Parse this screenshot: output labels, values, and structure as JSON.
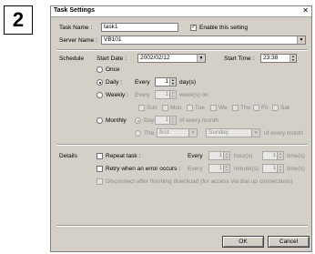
{
  "badge": "2",
  "window": {
    "title": "Task Settings",
    "close_icon": "close-icon"
  },
  "task_name": {
    "label": "Task Name :",
    "value": "task1"
  },
  "enable": {
    "label": "Enable this setting",
    "checked": true
  },
  "server_name": {
    "label": "Server Name :",
    "value": "VB101"
  },
  "schedule": {
    "label": "Schedule",
    "start_date_label": "Start Date :",
    "start_date": "2002/02/12",
    "start_time_label": "Start Time :",
    "start_time": "23:38",
    "once": "Once",
    "daily": "Daily :",
    "daily_every": "Every",
    "daily_value": "1",
    "daily_unit": "day(s)",
    "weekly": "Weekly :",
    "weekly_every": "Every",
    "weekly_value": "1",
    "weekly_unit": "week(s) on",
    "days": [
      "Sun",
      "Mon",
      "Tue",
      "We",
      "Thu",
      "Fri",
      "Sat"
    ],
    "monthly": "Monthly",
    "day_label": "Day",
    "day_value": "1",
    "of_every_month": "of every month",
    "the_label": "The",
    "the_value": "first",
    "weekday_value": "Sunday",
    "of_every_month2": "of every month"
  },
  "details": {
    "label": "Details",
    "repeat": "Repeat task :",
    "repeat_every": "Every",
    "repeat_value": "1",
    "repeat_unit": "hour(s)",
    "repeat_times": "1",
    "repeat_times_unit": "time(s)",
    "retry": "Retry when an error occurs :",
    "retry_every": "Every",
    "retry_value": "1",
    "retry_unit": "minute(s)",
    "retry_times": "1",
    "retry_times_unit": "time(s)",
    "disconnect": "Disconnect after finishing download (for access via dial up connections)"
  },
  "buttons": {
    "ok": "OK",
    "cancel": "Cancel"
  }
}
